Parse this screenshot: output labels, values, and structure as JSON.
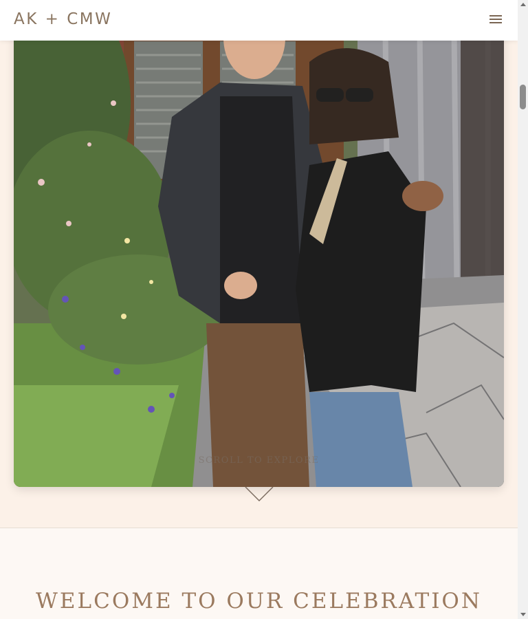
{
  "header": {
    "brand": "AK + CMW",
    "menu_icon": "hamburger-menu-icon"
  },
  "hero": {
    "photo_description_icon": "couple-photo",
    "scroll_cue": "SCROLL TO EXPLORE",
    "scroll_icon": "chevron-down-icon"
  },
  "welcome": {
    "title": "WELCOME TO OUR CELEBRATION"
  },
  "colors": {
    "accent": "#9b7a5f",
    "brand": "#8a7560",
    "background": "#fdf8f4",
    "hero_background": "#fcf1e8"
  }
}
